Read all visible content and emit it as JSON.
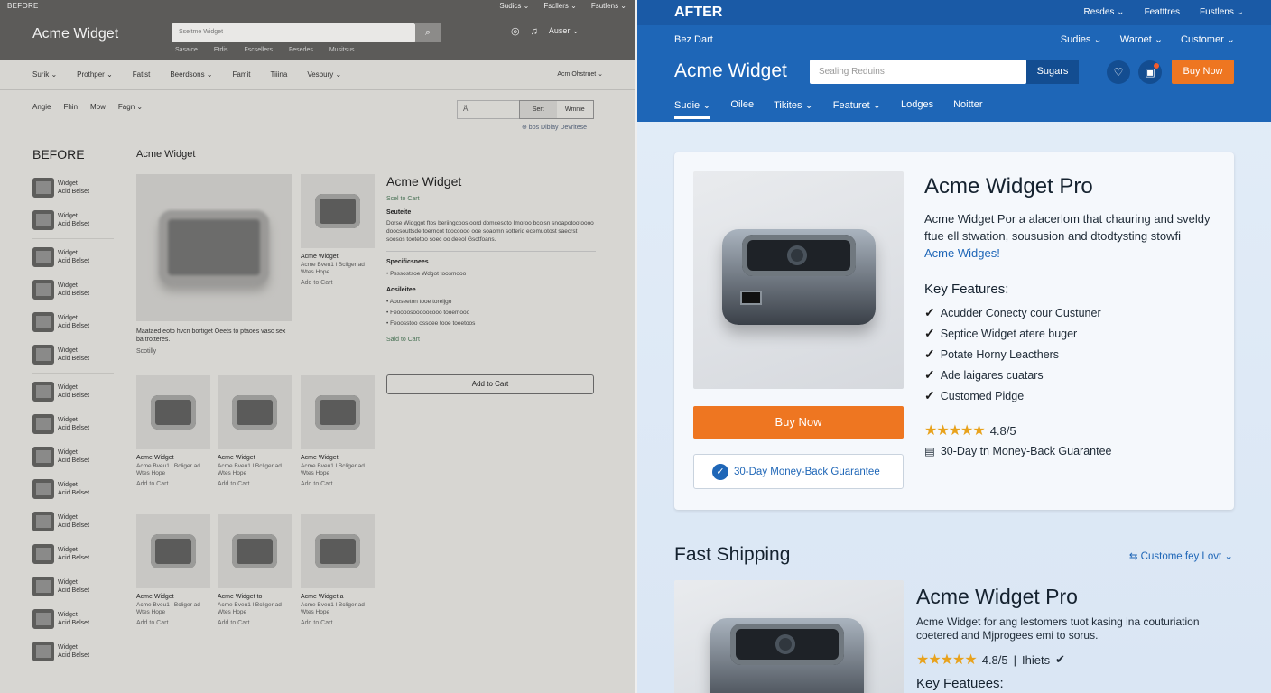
{
  "before": {
    "tag": "BEFORE",
    "top_links": [
      "Sudics ⌄",
      "Fscllers ⌄",
      "Fsutlens ⌄"
    ],
    "logo": "Acme Widget",
    "search_placeholder": "Sseltme Widget",
    "search_sublinks": [
      "Sasaice",
      "Etdis",
      "Fscsellers",
      "Fesedes",
      "Musitsus"
    ],
    "user_label": "Auser ⌄",
    "nav": [
      "Surik ⌄",
      "Prothper ⌄",
      "Fatist",
      "Beerdsons ⌄",
      "Famit",
      "Tiiina",
      "Vesbury ⌄"
    ],
    "nav_right": "Acm Ohstruet ⌄",
    "filters": [
      "Angie",
      "Fhin",
      "Mow",
      "Fagn ⌄"
    ],
    "filter_box": "Ä",
    "toggle": [
      "Sert",
      "Wmnie"
    ],
    "breadcrumb_link": "⊕ bos Diblay Devritese",
    "label": "BEFORE",
    "product_title": "Acme Widget",
    "sidebar_items": [
      {
        "name": "Widget",
        "sub": "Acid Belset"
      },
      {
        "name": "Widget",
        "sub": "Acid Belset"
      },
      {
        "name": "Widget",
        "sub": "Acid Belset"
      },
      {
        "name": "Widget",
        "sub": "Acid Belset"
      },
      {
        "name": "Widget",
        "sub": "Acid Belset"
      },
      {
        "name": "Widget",
        "sub": "Acid Belset"
      },
      {
        "name": "Widget",
        "sub": "Acid Belset"
      },
      {
        "name": "Widget",
        "sub": "Acid Belset"
      },
      {
        "name": "Widget",
        "sub": "Acid Belset"
      },
      {
        "name": "Widget",
        "sub": "Acid Belset"
      },
      {
        "name": "Widget",
        "sub": "Acid Belset"
      },
      {
        "name": "Widget",
        "sub": "Acid Belset"
      },
      {
        "name": "Widget",
        "sub": "Acid Belset"
      },
      {
        "name": "Widget",
        "sub": "Acid Belset"
      },
      {
        "name": "Widget",
        "sub": "Acid Belset"
      }
    ],
    "main_desc": "Maataed eoto hvcn bortiget Oeets to ptaoes vasc sex ba trotteres.",
    "main_sub": "Scotilly",
    "cards": [
      {
        "title": "Acme Widget",
        "sub": "Acme Bveu1 l Bcliger ad Wtes Hope",
        "action": "Add to Cart"
      },
      {
        "title": "Acme Widget",
        "sub": "Acme Bveu1 l Bcliger ad Wtes Hope",
        "action": "Add to Cart"
      },
      {
        "title": "Acme Widget",
        "sub": "Acme Bveu1 l Bcliger ad Wtes Hope",
        "action": "Add to Cart"
      },
      {
        "title": "Acme Widget",
        "sub": "Acme Bveu1 l Bcliger ad Wtes Hope",
        "action": "Add to Cart"
      },
      {
        "title": "Acme Widget",
        "sub": "Acme Bveu1 l Bcliger ad Wtes Hope",
        "action": "Add to Cart"
      },
      {
        "title": "Acme Widget to",
        "sub": "Acme Bveu1 l Bcliger ad Wtes Hope",
        "action": "Add to Cart"
      },
      {
        "title": "Acme Widget a",
        "sub": "Acme Bveu1 l Bcliger ad Wtes Hope",
        "action": "Add to Cart"
      }
    ],
    "info": {
      "title": "Acme Widget",
      "green1": "Scel to Cart",
      "sec1": "Seuteite",
      "text1": "Dorse Widggot ftos beriingcoos oord domcesoto Imoroo bcolsn snoapotootoooo doocsouttsde toerncot toocoooo ooe soaomn sotterid ecemuotost saecrst soosos toetetoo soec oo deeol Gsotfoans.",
      "sec2": "Specificsnees",
      "spec_items": [
        "Psssostsoe Wdgot toosmooo"
      ],
      "sec3": "Acsileitee",
      "avail_items": [
        "Aooseeton tooe toreijgo",
        "Feoooosooooocooo tooemooo",
        "Feoosstoo ossoee tooe toeetoos"
      ],
      "green2": "Sald to Cart"
    },
    "add_to_cart": "Add to Cart"
  },
  "after": {
    "tag": "AFTER",
    "top_links": [
      "Resdes ⌄",
      "Featttres",
      "Fustlens ⌄"
    ],
    "bez": "Bez Dart",
    "links2": [
      "Sudies ⌄",
      "Waroet ⌄",
      "Customer ⌄"
    ],
    "logo": "Acme Widget",
    "search_placeholder": "Sealing Reduins",
    "search_button": "Sugars",
    "buy_now_header": "Buy Now",
    "nav": [
      "Sudie ⌄",
      "Oilee",
      "Tikites ⌄",
      "Featuret ⌄",
      "Lodges",
      "Noitter"
    ],
    "product": {
      "title": "Acme Widget Pro",
      "desc_prefix": "Acme Widget Por a alacerlom that chauring and sveldy ftue ell stwation, soususion and dtodtysting stowfi ",
      "desc_link": "Acme Widges!",
      "key_features_title": "Key Features:",
      "features": [
        "Acudder Conecty cour Custuner",
        "Septice Widget atere buger",
        "Potate Horny Leacthers",
        "Ade laigares cuatars",
        "Customed Pidge"
      ],
      "rating": "4.8/5",
      "guarantee": "30-Day tn Money-Back Guarantee",
      "buy_now": "Buy Now",
      "guarantee_box": "30-Day Money-Back Guarantee"
    },
    "fast_shipping": "Fast Shipping",
    "customer_link": "⇆ Custome fey Lovt ⌄",
    "product2": {
      "title": "Acme Widget Pro",
      "desc": "Acme Widget for ang lestomers tuot kasing ina couturiation coetered and Mjprogees emi to sorus.",
      "rating": "4.8/5",
      "sep": "|",
      "rating_extra": "Ihiets",
      "key_features_title": "Key Featuees:"
    },
    "colors": {
      "brand_blue": "#1e66b7",
      "accent_orange": "#ee7621",
      "star": "#e8a21c"
    }
  }
}
